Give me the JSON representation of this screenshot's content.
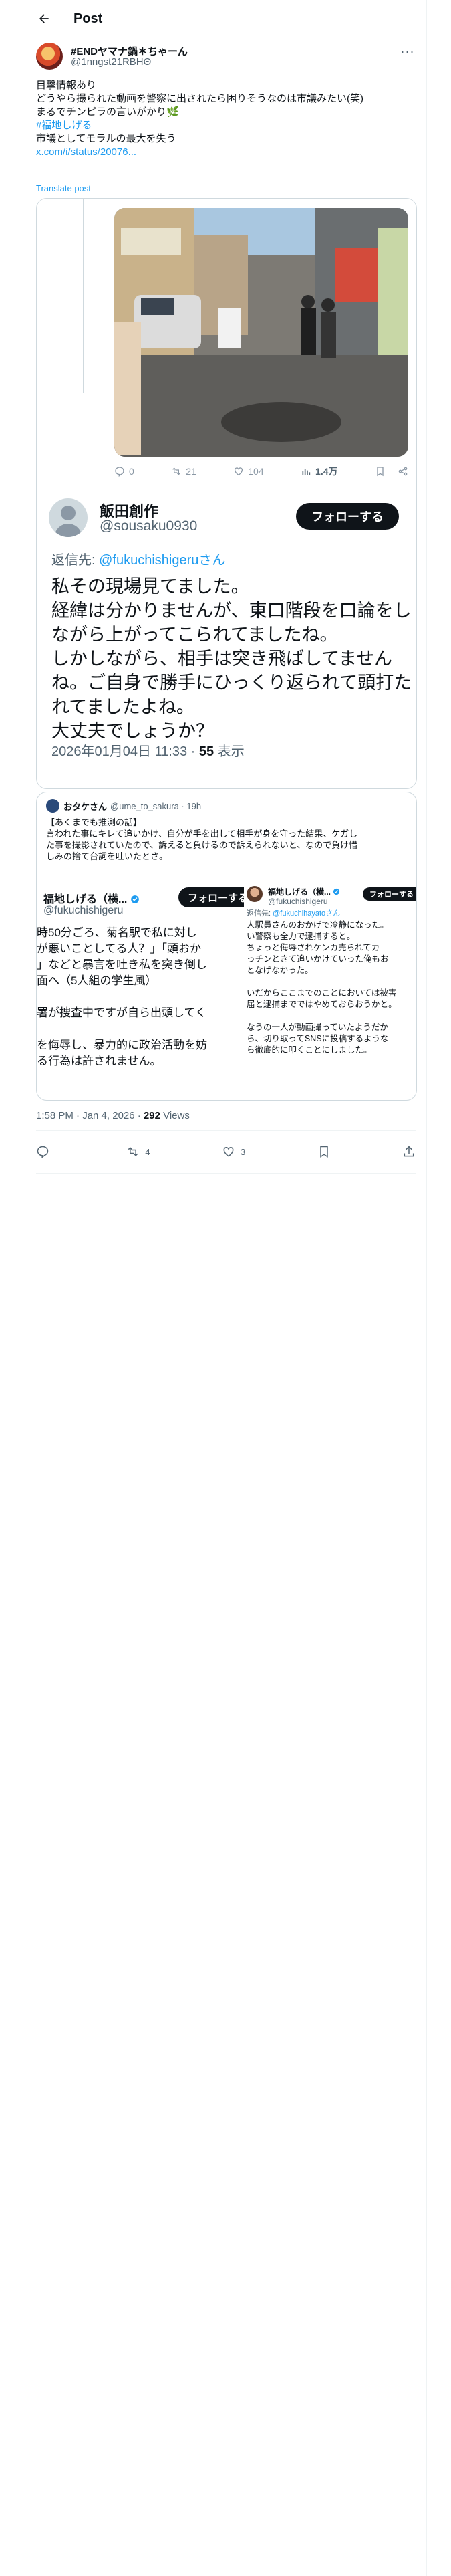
{
  "header": {
    "title": "Post"
  },
  "author": {
    "name": "#ENDヤマナ鍋＊ちゃーん",
    "handle": "@1nngst21RBHΘ"
  },
  "tweet": {
    "lines": [
      "目撃情報あり",
      "どうやら撮られた動画を警察に出されたら困りそうなのは市議みたい(笑)",
      "まるでチンピラの言いがかり🌿"
    ],
    "hashtag": "#福地しげる",
    "line_after": "市議としてモラルの最大を失う",
    "link": "x.com/i/status/20076...",
    "translate": "Translate post"
  },
  "quoted_screenshot": {
    "small_actions": {
      "reply": "0",
      "retweet": "21",
      "like": "104",
      "views": "1.4万"
    },
    "reply_name": "飯田創作",
    "reply_handle": "@sousaku0930",
    "follow_label": "フォローする",
    "replying_prefix": "返信先: ",
    "replying_to": "@fukuchishigeruさん",
    "reply_lines": [
      "私その現場見てました。",
      "経緯は分かりませんが、東口階段を口論をし",
      "ながら上がってこられてましたね。",
      "しかしながら、相手は突き飛ばしてません",
      "ね。ご自身で勝手にひっくり返られて頭打た",
      "れてましたよね。",
      "大丈夫でしょうか？"
    ],
    "reply_date": "2026年01月04日 11:33 · ",
    "reply_views_count": "55",
    "reply_views_label": " 表示"
  },
  "second_screenshot": {
    "name": "おタケさん",
    "handle": "@ume_to_sakura · 19h",
    "lines": [
      "【あくまでも推測の話】",
      "言われた事にキレて追いかけ、自分が手を出して相手が身を守った結果、ケガし",
      "た事を撮影されていたので、訴えると負けるので訴えられないと、なので負け惜",
      "しみの捨て台詞を吐いたとさ。"
    ],
    "left": {
      "name": "福地しげる（横...",
      "handle": "@fukuchishigeru",
      "follow_label": "フォローする",
      "lines": [
        "時50分ごろ、菊名駅で私に対し",
        "が悪いことしてる人？」「頭おか",
        "」などと暴言を吐き私を突き倒し",
        "面へ（5人組の学生風）",
        "",
        "署が捜査中ですが自ら出頭してく",
        "",
        "を侮辱し、暴力的に政治活動を妨",
        "る行為は許されません。"
      ]
    },
    "right": {
      "name": "福地しげる（横...",
      "handle": "@fukuchishigeru",
      "follow_label": "フォローする",
      "replying_prefix": "返信先: ",
      "replying_to": "@fukuchihayatoさん",
      "lines": [
        "人駅員さんのおかげで冷静になった。",
        "い警察も全力で逮捕すると。",
        "ちょっと侮辱されケンカ売られてカ",
        "っチンときて追いかけていった俺もお",
        "となげなかった。",
        "",
        "いだからここまでのことにおいては被害",
        "届と逮捕までではやめておらおうかと。",
        "",
        "なうの一人が動画撮っていたようだか",
        "ら、切り取ってSNSに投稿するような",
        "ら徹底的に叩くことにしました。"
      ]
    }
  },
  "meta": {
    "time": "1:58 PM · Jan 4, 2026 · ",
    "views_count": "292",
    "views_label": " Views"
  },
  "actions": {
    "reply": "",
    "retweet": "4",
    "like": "3"
  }
}
